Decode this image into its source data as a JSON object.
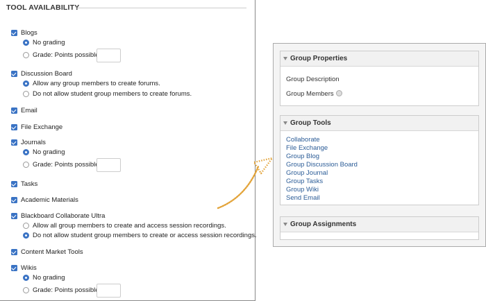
{
  "tool_availability": {
    "title": "TOOL AVAILABILITY",
    "tools": [
      {
        "label": "Blogs",
        "checked": true,
        "options": [
          {
            "label": "No grading",
            "selected": true
          },
          {
            "label": "Grade: Points possible:",
            "selected": false,
            "points_value": ""
          }
        ]
      },
      {
        "label": "Discussion Board",
        "checked": true,
        "options": [
          {
            "label": "Allow any group members to create forums.",
            "selected": true
          },
          {
            "label": "Do not allow student group members to create forums.",
            "selected": false
          }
        ]
      },
      {
        "label": "Email",
        "checked": true
      },
      {
        "label": "File Exchange",
        "checked": true
      },
      {
        "label": "Journals",
        "checked": true,
        "options": [
          {
            "label": "No grading",
            "selected": true
          },
          {
            "label": "Grade: Points possible:",
            "selected": false,
            "points_value": ""
          }
        ]
      },
      {
        "label": "Tasks",
        "checked": true
      },
      {
        "label": "Academic Materials",
        "checked": true
      },
      {
        "label": "Blackboard Collaborate Ultra",
        "checked": true,
        "options": [
          {
            "label": "Allow all group members to create and access session recordings.",
            "selected": false
          },
          {
            "label": "Do not allow student group members to create or access session recordings.",
            "selected": true
          }
        ]
      },
      {
        "label": "Content Market Tools",
        "checked": true
      },
      {
        "label": "Wikis",
        "checked": true,
        "options": [
          {
            "label": "No grading",
            "selected": true
          },
          {
            "label": "Grade: Points possible:",
            "selected": false,
            "points_value": ""
          }
        ]
      }
    ]
  },
  "group_properties": {
    "title": "Group Properties",
    "description_label": "Group Description",
    "members_label": "Group Members"
  },
  "group_tools": {
    "title": "Group Tools",
    "links": [
      "Collaborate",
      "File Exchange",
      "Group Blog",
      "Group Discussion Board",
      "Group Journal",
      "Group Tasks",
      "Group Wiki",
      "Send Email"
    ]
  },
  "group_assignments": {
    "title": "Group Assignments"
  },
  "colors": {
    "accent": "#3a73c4",
    "link": "#2a5b96",
    "arrow": "#e3a43a"
  }
}
